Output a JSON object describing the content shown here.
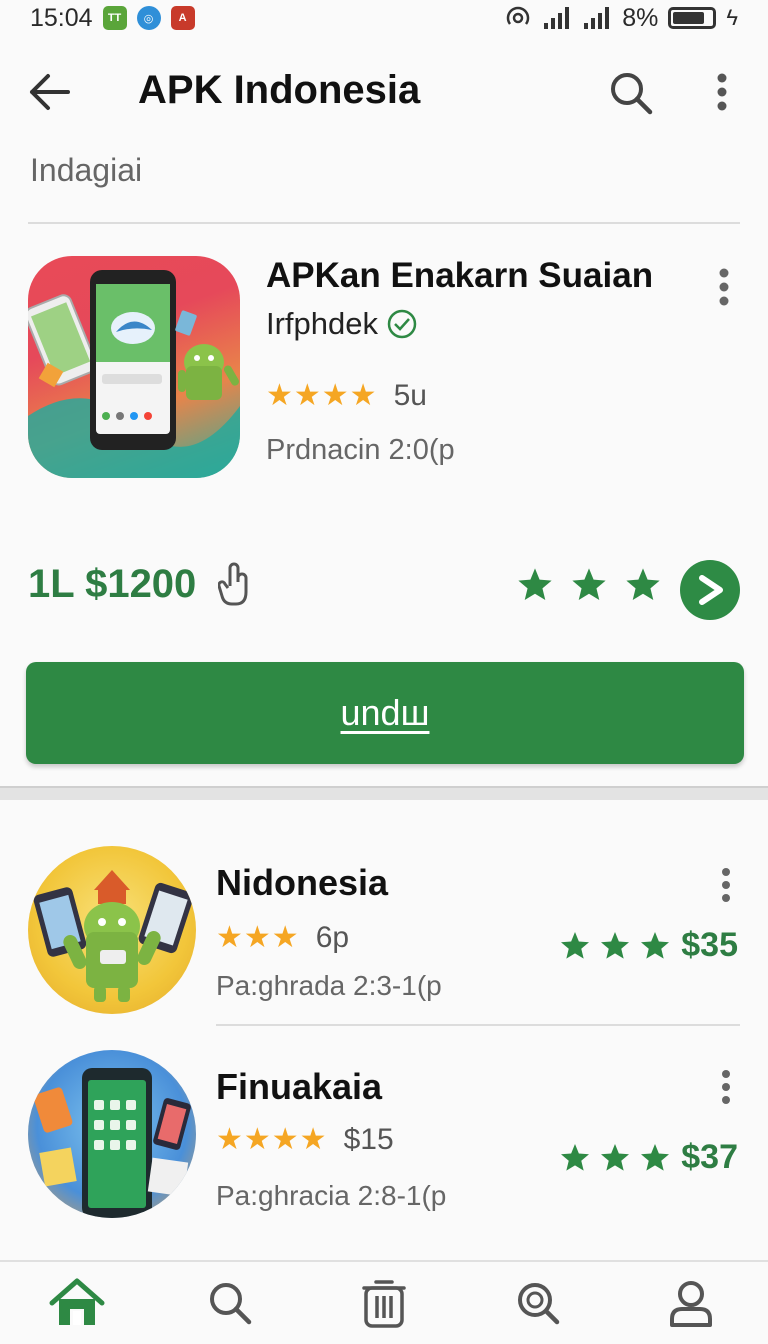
{
  "status_bar": {
    "time": "15:04",
    "battery": "8%",
    "battery_level": 0.8
  },
  "app_bar": {
    "title": "APK Indonesia"
  },
  "section": {
    "label": "Indagiai"
  },
  "featured": {
    "title": "APKan Enakarn Suaian",
    "developer": "Irfphdek",
    "rating_stars": "★★★★",
    "rating_count": "5u",
    "meta": "Prdnacin 2:0(p",
    "price": "1L $1200",
    "green_stars": 3,
    "download_label": "undш"
  },
  "list": [
    {
      "title": "Nidonesia",
      "rating_stars": "★★★",
      "rating_count": "6p",
      "meta": "Pa:ghrada 2:3-1(p",
      "price": "$35",
      "green_stars": 3
    },
    {
      "title": "Finuakaia",
      "rating_stars": "★★★★",
      "rating_count": "$15",
      "meta": "Pa:ghracia 2:8-1(p",
      "price": "$37",
      "green_stars": 3
    }
  ],
  "colors": {
    "accent_green": "#2e8944",
    "star_gold": "#f5a623"
  },
  "icons": [
    "arrow-left-icon",
    "search-icon",
    "more-vert-icon",
    "verified-icon",
    "touch-icon",
    "play-icon",
    "home-icon",
    "trash-icon",
    "explore-icon",
    "profile-icon"
  ]
}
